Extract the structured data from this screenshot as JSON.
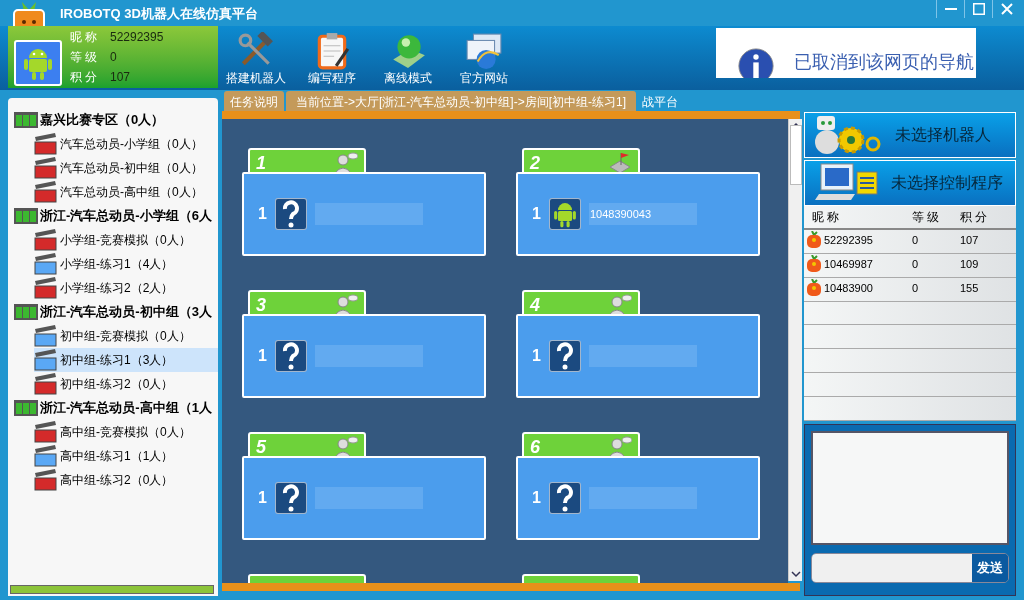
{
  "window": {
    "title": "IROBOTQ 3D机器人在线仿真平台"
  },
  "user": {
    "fields": [
      {
        "label": "昵 称",
        "value": "52292395"
      },
      {
        "label": "等 级",
        "value": "0"
      },
      {
        "label": "积 分",
        "value": "107"
      }
    ]
  },
  "toolbar": [
    {
      "kind": "build",
      "label": "搭建机器人"
    },
    {
      "kind": "program",
      "label": "编写程序"
    },
    {
      "kind": "offline",
      "label": "离线模式"
    },
    {
      "kind": "website",
      "label": "官方网站"
    }
  ],
  "banner": {
    "text": "已取消到该网页的导航"
  },
  "tabs": [
    {
      "label": "任务说明",
      "selected": true
    },
    {
      "label": "战平台",
      "selected": false
    }
  ],
  "location": "当前位置->大厅[浙江-汽车总动员-初中组]->房间[初中组-练习1]",
  "lobby": [
    {
      "label": "嘉兴比赛专区（0人）",
      "children": [
        {
          "label": "汽车总动员-小学组（0人）",
          "color": "#d42a2a",
          "selected": false
        },
        {
          "label": "汽车总动员-初中组（0人）",
          "color": "#d42a2a",
          "selected": false
        },
        {
          "label": "汽车总动员-高中组（0人）",
          "color": "#d42a2a",
          "selected": false
        }
      ]
    },
    {
      "label": "浙江-汽车总动员-小学组（6人",
      "children": [
        {
          "label": "小学组-竞赛模拟（0人）",
          "color": "#d42a2a",
          "selected": false
        },
        {
          "label": "小学组-练习1（4人）",
          "color": "#5aa8f5",
          "selected": false
        },
        {
          "label": "小学组-练习2（2人）",
          "color": "#d42a2a",
          "selected": false
        }
      ]
    },
    {
      "label": "浙江-汽车总动员-初中组（3人",
      "children": [
        {
          "label": "初中组-竞赛模拟（0人）",
          "color": "#5aa8f5",
          "selected": false
        },
        {
          "label": "初中组-练习1（3人）",
          "color": "#5aa8f5",
          "selected": true
        },
        {
          "label": "初中组-练习2（0人）",
          "color": "#d42a2a",
          "selected": false
        }
      ]
    },
    {
      "label": "浙江-汽车总动员-高中组（1人",
      "children": [
        {
          "label": "高中组-竞赛模拟（0人）",
          "color": "#d42a2a",
          "selected": false
        },
        {
          "label": "高中组-练习1（1人）",
          "color": "#5aa8f5",
          "selected": false
        },
        {
          "label": "高中组-练习2（0人）",
          "color": "#d42a2a",
          "selected": false
        }
      ]
    }
  ],
  "rooms": [
    {
      "number": "1",
      "host": false,
      "slot": "1",
      "occupied": false
    },
    {
      "number": "2",
      "host": true,
      "slot": "1",
      "occupied": true,
      "name": "1048390043"
    },
    {
      "number": "3",
      "host": false,
      "slot": "1",
      "occupied": false
    },
    {
      "number": "4",
      "host": false,
      "slot": "1",
      "occupied": false
    },
    {
      "number": "5",
      "host": false,
      "slot": "1",
      "occupied": false
    },
    {
      "number": "6",
      "host": false,
      "slot": "1",
      "occupied": false
    },
    {
      "partial": true
    },
    {
      "partial": true
    }
  ],
  "robot_button": "未选择机器人",
  "program_button": "未选择控制程序",
  "players": {
    "columns": [
      "昵 称",
      "等 级",
      "积 分"
    ],
    "rows": [
      [
        "52292395",
        "0",
        "107"
      ],
      [
        "10469987",
        "0",
        "109"
      ],
      [
        "10483900",
        "0",
        "155"
      ]
    ]
  },
  "chat": {
    "send": "发送"
  }
}
